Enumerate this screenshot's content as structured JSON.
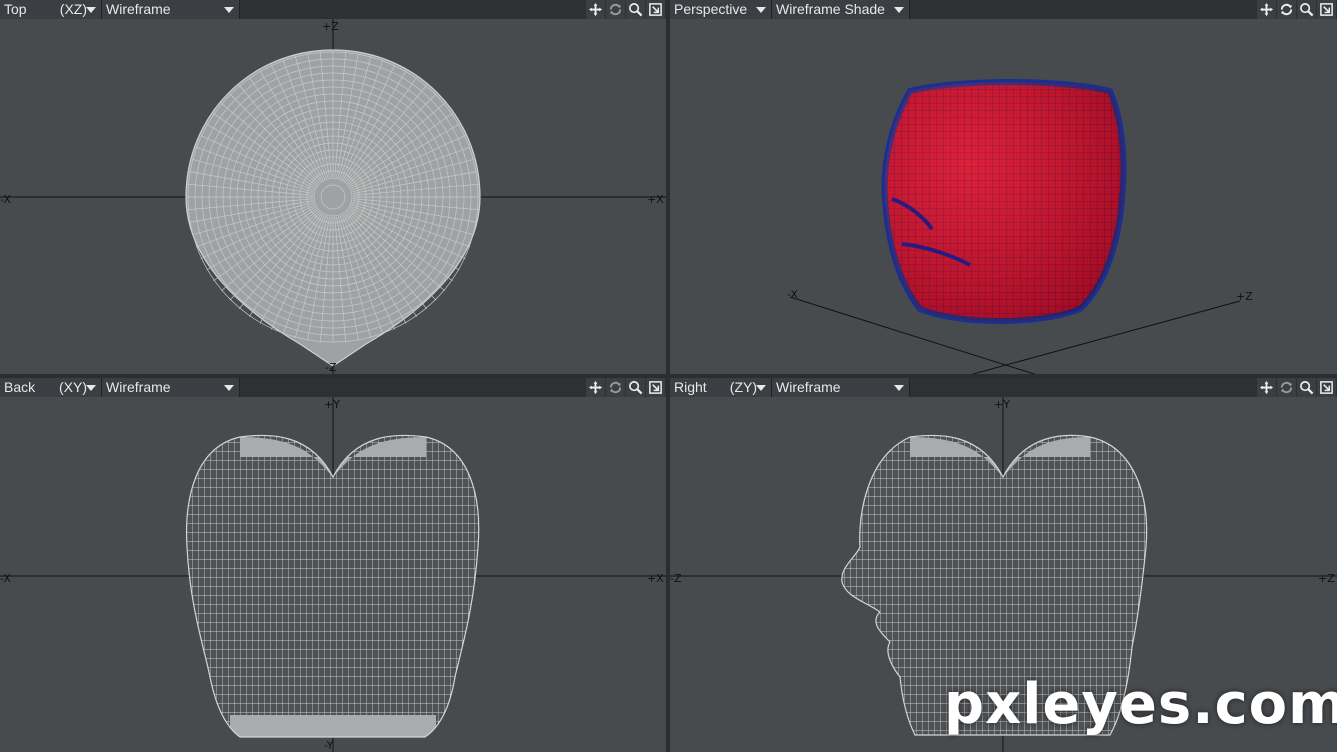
{
  "viewports": {
    "top": {
      "view": "Top",
      "plane": "(XZ)",
      "mode": "Wireframe",
      "axes": {
        "up": "+Z",
        "down": "-Z",
        "left": "-X",
        "right": "+X"
      }
    },
    "perspective": {
      "view": "Perspective",
      "mode": "Wireframe Shade",
      "axes": {
        "left": "-X",
        "right": "+Z"
      }
    },
    "back": {
      "view": "Back",
      "plane": "(XY)",
      "mode": "Wireframe",
      "axes": {
        "up": "+Y",
        "down": "-Y",
        "left": "-X",
        "right": "+X"
      }
    },
    "right": {
      "view": "Right",
      "plane": "(ZY)",
      "mode": "Wireframe",
      "axes": {
        "up": "+Y",
        "down": "-Y",
        "left": "-Z",
        "right": "+Z"
      }
    }
  },
  "toolbar_icons": [
    "move-view-icon",
    "rotate-view-icon",
    "zoom-view-icon",
    "maximize-view-icon"
  ],
  "watermark": "pxleyes.com",
  "colors": {
    "viewport_bg": "#484b4e",
    "wire": "#c8c8c8",
    "shade_red": "#d1102a",
    "shade_edge": "#1b2f8f"
  }
}
